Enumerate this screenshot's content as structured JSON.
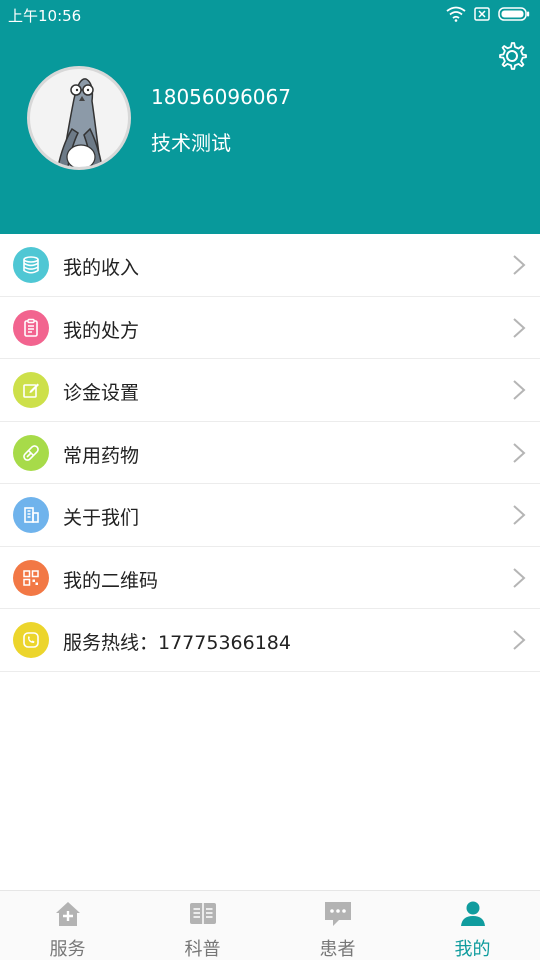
{
  "status_bar": {
    "time": "上午10:56"
  },
  "profile": {
    "phone": "18056096067",
    "nickname": "技术测试"
  },
  "menu": [
    {
      "label": "我的收入",
      "icon": "database-icon",
      "color": "#4fc7d4"
    },
    {
      "label": "我的处方",
      "icon": "clipboard-icon",
      "color": "#f2648f"
    },
    {
      "label": "诊金设置",
      "icon": "edit-icon",
      "color": "#cde04a"
    },
    {
      "label": "常用药物",
      "icon": "pill-icon",
      "color": "#a7db49"
    },
    {
      "label": "关于我们",
      "icon": "building-icon",
      "color": "#6fb3ec"
    },
    {
      "label": "我的二维码",
      "icon": "qrcode-icon",
      "color": "#f27845"
    },
    {
      "label": "服务热线：17775366184",
      "icon": "phone-icon",
      "color": "#ecd52c"
    }
  ],
  "tabbar": [
    {
      "label": "服务",
      "icon": "home-plus-icon",
      "active": false
    },
    {
      "label": "科普",
      "icon": "book-icon",
      "active": false
    },
    {
      "label": "患者",
      "icon": "chat-icon",
      "active": false
    },
    {
      "label": "我的",
      "icon": "user-icon",
      "active": true
    }
  ],
  "colors": {
    "header": "#08999b",
    "accent": "#109c9e",
    "inactive": "#b3b3b3"
  }
}
